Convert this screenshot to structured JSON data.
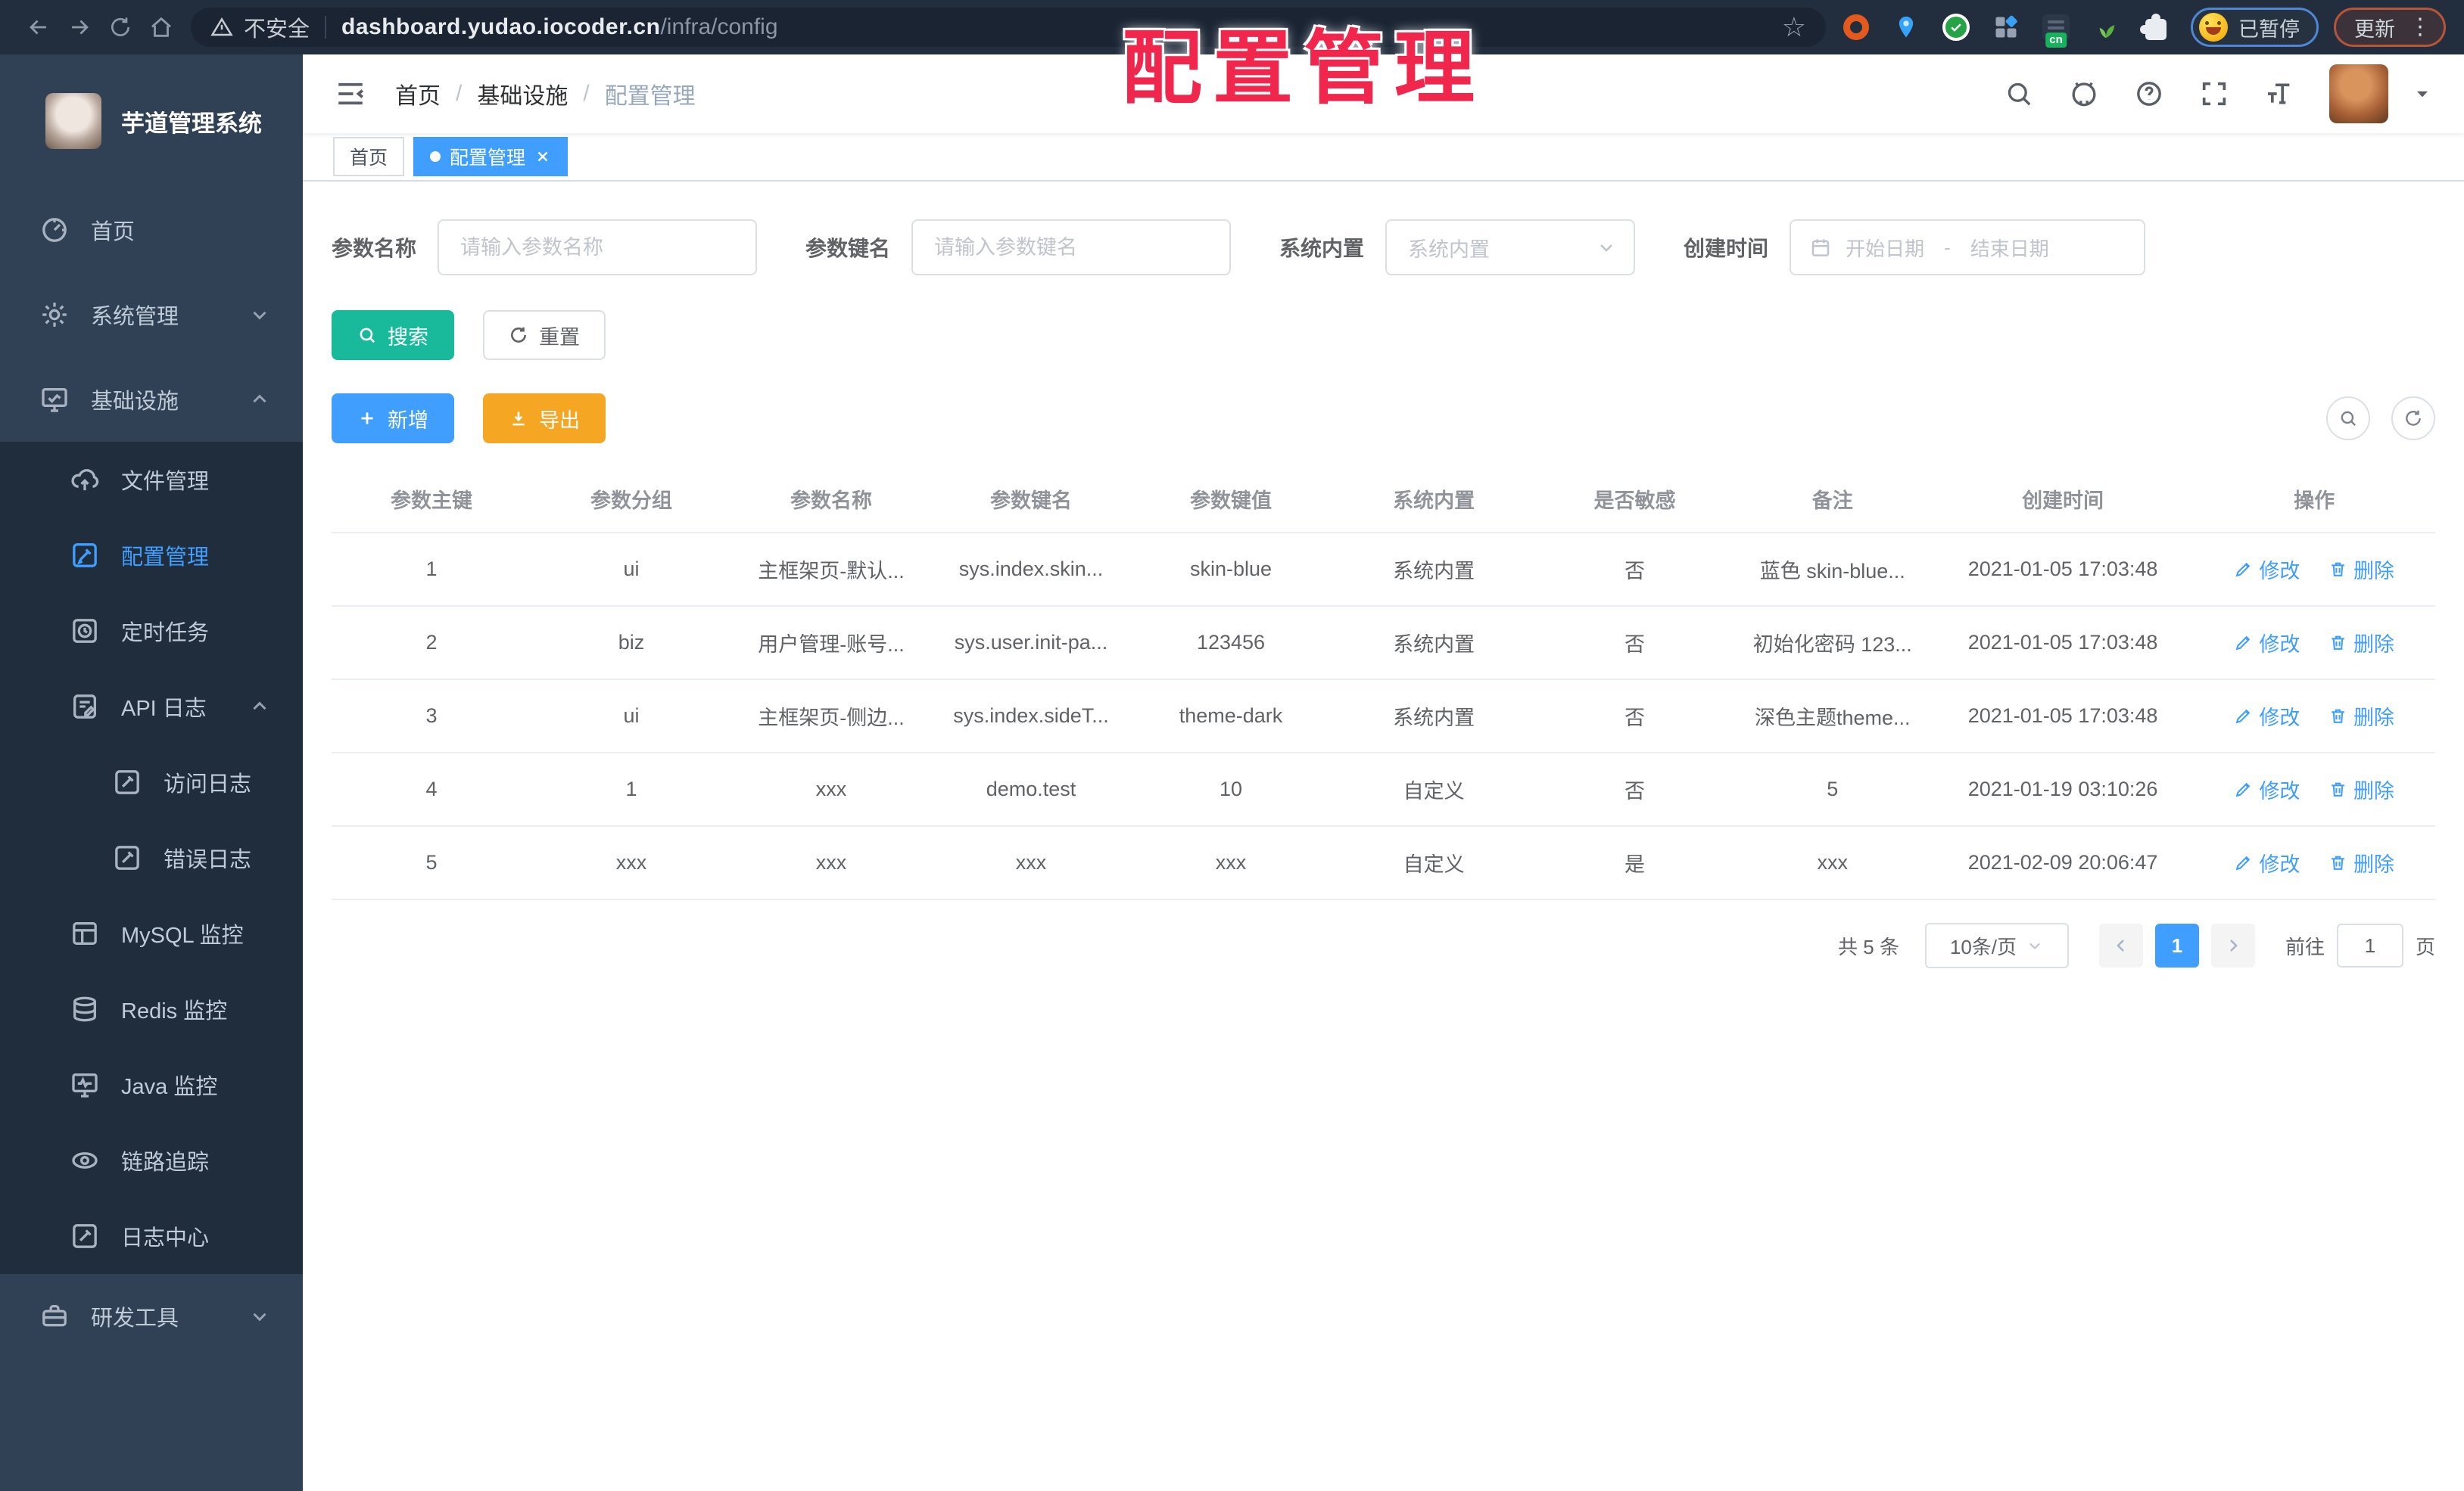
{
  "browser": {
    "security_label": "不安全",
    "url_domain": "dashboard.yudao.iocoder.cn",
    "url_path": "/infra/config",
    "ext_badge": "cn",
    "paused_label": "已暂停",
    "update_label": "更新"
  },
  "overlay": {
    "title": "配置管理"
  },
  "sidebar": {
    "app_title": "芋道管理系统",
    "items": [
      {
        "label": "首页"
      },
      {
        "label": "系统管理"
      },
      {
        "label": "基础设施"
      },
      {
        "label": "文件管理"
      },
      {
        "label": "配置管理"
      },
      {
        "label": "定时任务"
      },
      {
        "label": "API 日志"
      },
      {
        "label": "访问日志"
      },
      {
        "label": "错误日志"
      },
      {
        "label": "MySQL 监控"
      },
      {
        "label": "Redis 监控"
      },
      {
        "label": "Java 监控"
      },
      {
        "label": "链路追踪"
      },
      {
        "label": "日志中心"
      },
      {
        "label": "研发工具"
      }
    ]
  },
  "navbar": {
    "breadcrumb": [
      "首页",
      "基础设施",
      "配置管理"
    ]
  },
  "tabs": [
    {
      "label": "首页"
    },
    {
      "label": "配置管理"
    }
  ],
  "filters": {
    "name_label": "参数名称",
    "name_placeholder": "请输入参数名称",
    "key_label": "参数键名",
    "key_placeholder": "请输入参数键名",
    "type_label": "系统内置",
    "type_placeholder": "系统内置",
    "date_label": "创建时间",
    "date_start": "开始日期",
    "date_sep": "-",
    "date_end": "结束日期",
    "search_label": "搜索",
    "reset_label": "重置"
  },
  "toolbar": {
    "add_label": "新增",
    "export_label": "导出"
  },
  "table": {
    "headers": [
      "参数主键",
      "参数分组",
      "参数名称",
      "参数键名",
      "参数键值",
      "系统内置",
      "是否敏感",
      "备注",
      "创建时间",
      "操作"
    ],
    "edit_label": "修改",
    "delete_label": "删除",
    "rows": [
      [
        "1",
        "ui",
        "主框架页-默认...",
        "sys.index.skin...",
        "skin-blue",
        "系统内置",
        "否",
        "蓝色 skin-blue...",
        "2021-01-05 17:03:48"
      ],
      [
        "2",
        "biz",
        "用户管理-账号...",
        "sys.user.init-pa...",
        "123456",
        "系统内置",
        "否",
        "初始化密码 123...",
        "2021-01-05 17:03:48"
      ],
      [
        "3",
        "ui",
        "主框架页-侧边...",
        "sys.index.sideT...",
        "theme-dark",
        "系统内置",
        "否",
        "深色主题theme...",
        "2021-01-05 17:03:48"
      ],
      [
        "4",
        "1",
        "xxx",
        "demo.test",
        "10",
        "自定义",
        "否",
        "5",
        "2021-01-19 03:10:26"
      ],
      [
        "5",
        "xxx",
        "xxx",
        "xxx",
        "xxx",
        "自定义",
        "是",
        "xxx",
        "2021-02-09 20:06:47"
      ]
    ]
  },
  "pagination": {
    "total_label": "共 5 条",
    "page_size": "10条/页",
    "current_page": "1",
    "goto_label": "前往",
    "goto_value": "1",
    "page_unit": "页"
  }
}
